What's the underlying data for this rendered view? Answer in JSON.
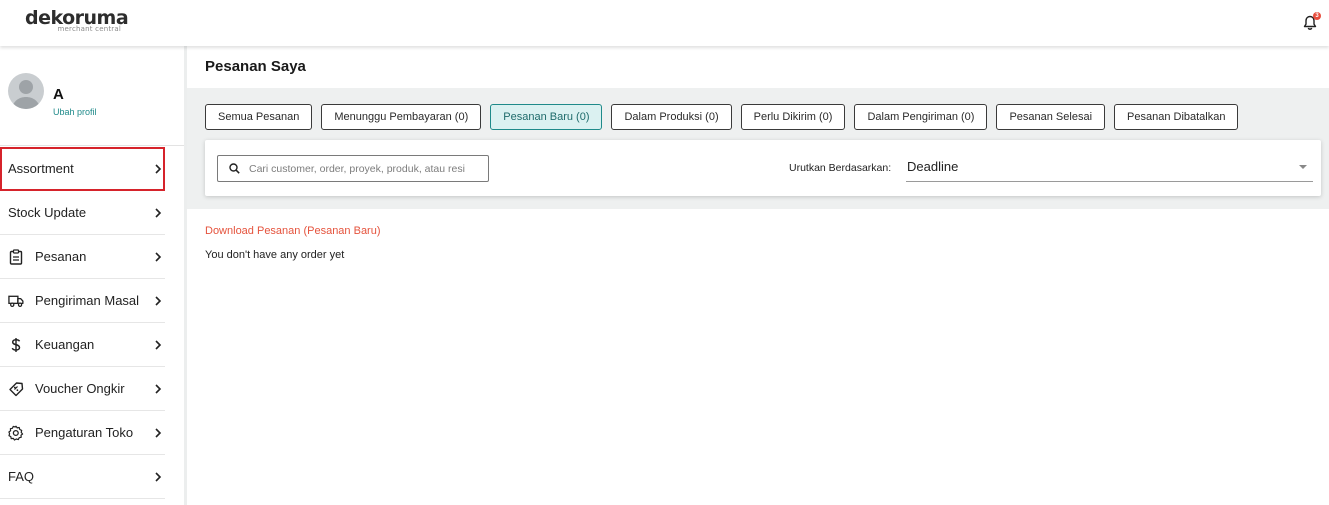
{
  "header": {
    "logo_main": "dekoruma",
    "logo_sub": "merchant central",
    "notification_badge": "3"
  },
  "profile": {
    "name": "A",
    "edit_label": "Ubah profil"
  },
  "sidebar": {
    "items": [
      {
        "label": "Assortment",
        "icon": "",
        "highlighted": true
      },
      {
        "label": "Stock Update",
        "icon": ""
      },
      {
        "label": "Pesanan",
        "icon": "clipboard-icon"
      },
      {
        "label": "Pengiriman Masal",
        "icon": "truck-icon"
      },
      {
        "label": "Keuangan",
        "icon": "dollar-icon"
      },
      {
        "label": "Voucher Ongkir",
        "icon": "voucher-tag-icon"
      },
      {
        "label": "Pengaturan Toko",
        "icon": "gear-icon"
      },
      {
        "label": "FAQ",
        "icon": ""
      }
    ]
  },
  "main": {
    "title": "Pesanan Saya",
    "tabs": [
      {
        "label": "Semua Pesanan",
        "active": false
      },
      {
        "label": "Menunggu Pembayaran (0)",
        "active": false
      },
      {
        "label": "Pesanan Baru (0)",
        "active": true
      },
      {
        "label": "Dalam Produksi (0)",
        "active": false
      },
      {
        "label": "Perlu Dikirim (0)",
        "active": false
      },
      {
        "label": "Dalam Pengiriman (0)",
        "active": false
      },
      {
        "label": "Pesanan Selesai",
        "active": false
      },
      {
        "label": "Pesanan Dibatalkan",
        "active": false
      }
    ],
    "search": {
      "placeholder": "Cari customer, order, proyek, produk, atau resi",
      "value": ""
    },
    "sort": {
      "label": "Urutkan Berdasarkan:",
      "value": "Deadline"
    },
    "download_link": "Download Pesanan (Pesanan Baru)",
    "empty_message": "You don't have any order yet"
  },
  "colors": {
    "accent": "#1f8a8a",
    "active_tab_bg": "#dbf1f1",
    "link_red": "#e5533d",
    "highlight_border": "#d6232b"
  }
}
